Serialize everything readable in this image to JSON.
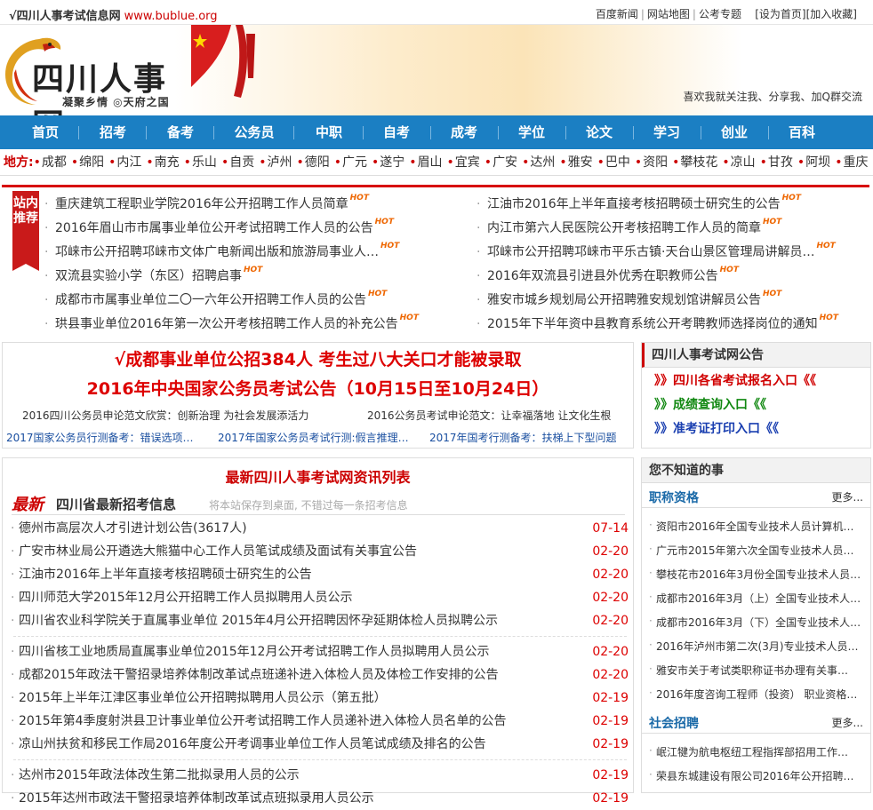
{
  "topbar": {
    "site_name": "√四川人事考试信息网",
    "site_url": "www.bublue.org",
    "links": [
      "百度新闻",
      "网站地图",
      "公考专题"
    ],
    "set_home": "[设为首页]",
    "add_fav": "[加入收藏]"
  },
  "header": {
    "logo_text": "四川人事网",
    "slogan": "凝聚乡情 ◎天府之国",
    "tagline": "喜欢我就关注我、分享我、加Q群交流"
  },
  "nav": [
    "首页",
    "招考",
    "备考",
    "公务员",
    "中职",
    "自考",
    "成考",
    "学位",
    "论文",
    "学习",
    "创业",
    "百科"
  ],
  "regions": {
    "label": "地方:",
    "items": [
      "成都",
      "绵阳",
      "内江",
      "南充",
      "乐山",
      "自贡",
      "泸州",
      "德阳",
      "广元",
      "遂宁",
      "眉山",
      "宜宾",
      "广安",
      "达州",
      "雅安",
      "巴中",
      "资阳",
      "攀枝花",
      "凉山",
      "甘孜",
      "阿坝",
      "重庆"
    ]
  },
  "recommend": {
    "badge": "站内推荐",
    "hot": "HOT",
    "left": [
      "重庆建筑工程职业学院2016年公开招聘工作人员简章",
      "2016年眉山市市属事业单位公开考试招聘工作人员的公告",
      "邛崃市公开招聘邛崃市文体广电新闻出版和旅游局事业人…",
      "双流县实验小学（东区）招聘启事",
      "成都市市属事业单位二〇一六年公开招聘工作人员的公告",
      "珙县事业单位2016年第一次公开考核招聘工作人员的补充公告"
    ],
    "right": [
      "江油市2016年上半年直接考核招聘硕士研究生的公告",
      "内江市第六人民医院公开考核招聘工作人员的简章",
      "邛崃市公开招聘邛崃市平乐古镇·天台山景区管理局讲解员…",
      "2016年双流县引进县外优秀在职教师公告",
      "雅安市城乡规划局公开招聘雅安规划馆讲解员公告",
      "2015年下半年资中县教育系统公开考聘教师选择岗位的通知"
    ]
  },
  "headline": {
    "h1": "√成都事业单位公招384人  考生过八大关口才能被录取",
    "h2": "2016年中央国家公务员考试公告（10月15日至10月24日）",
    "sub_left": "2016四川公务员申论范文欣赏：创新治理 为社会发展添活力",
    "sub_right": "2016公务员考试申论范文：让幸福落地 让文化生根",
    "blue": [
      "2017国家公务员行测备考：错误选项…",
      "2017年国家公务员考试行测:假言推理…",
      "2017年国考行测备考：扶梯上下型问题"
    ]
  },
  "notice": {
    "title": "四川人事考试网公告",
    "links": [
      {
        "text": "》》四川各省考试报名入口《《",
        "color": "#d00000"
      },
      {
        "text": "》》成绩查询入口《《",
        "color": "#118811"
      },
      {
        "text": "》》准考证打印入口《《",
        "color": "#1a3fb0"
      }
    ]
  },
  "news": {
    "title": "最新四川人事考试网资讯列表",
    "zuixin": "最新",
    "subtitle": "四川省最新招考信息",
    "hint": "将本站保存到桌面, 不错过每一条招考信息",
    "rows": [
      {
        "t": "德州市高层次人才引进计划公告(3617人)",
        "d": "07-14"
      },
      {
        "t": "广安市林业局公开遴选大熊猫中心工作人员笔试成绩及面试有关事宜公告",
        "d": "02-20"
      },
      {
        "t": "江油市2016年上半年直接考核招聘硕士研究生的公告",
        "d": "02-20"
      },
      {
        "t": "四川师范大学2015年12月公开招聘工作人员拟聘用人员公示",
        "d": "02-20"
      },
      {
        "t": "四川省农业科学院关于直属事业单位 2015年4月公开招聘因怀孕延期体检人员拟聘公示",
        "d": "02-20"
      },
      {
        "t": "四川省核工业地质局直属事业单位2015年12月公开考试招聘工作人员拟聘用人员公示",
        "d": "02-20"
      },
      {
        "t": "成都2015年政法干警招录培养体制改革试点班递补进入体检人员及体检工作安排的公告",
        "d": "02-20"
      },
      {
        "t": "2015年上半年江津区事业单位公开招聘拟聘用人员公示（第五批）",
        "d": "02-19"
      },
      {
        "t": "2015年第4季度射洪县卫计事业单位公开考试招聘工作人员递补进入体检人员名单的公告",
        "d": "02-19"
      },
      {
        "t": "凉山州扶贫和移民工作局2016年度公开考调事业单位工作人员笔试成绩及排名的公告",
        "d": "02-19"
      },
      {
        "t": "达州市2015年政法体改生第二批拟录用人员的公示",
        "d": "02-19"
      },
      {
        "t": "2015年达州市政法干警招录培养体制改革试点班拟录用人员公示",
        "d": "02-19"
      }
    ]
  },
  "side": {
    "title": "您不知道的事",
    "sec1": "职称资格",
    "sec2": "社会招聘",
    "more": "更多...",
    "list1": [
      "资阳市2016年全国专业技术人员计算机…",
      "广元市2015年第六次全国专业技术人员…",
      "攀枝花市2016年3月份全国专业技术人员…",
      "成都市2016年3月（上）全国专业技术人…",
      "成都市2016年3月（下）全国专业技术人…",
      "2016年泸州市第二次(3月)专业技术人员…",
      "雅安市关于考试类职称证书办理有关事…",
      "2016年度咨询工程师（投资） 职业资格…"
    ],
    "list2": [
      "岷江犍为航电枢纽工程指挥部招用工作…",
      "荣县东城建设有限公司2016年公开招聘…"
    ]
  }
}
